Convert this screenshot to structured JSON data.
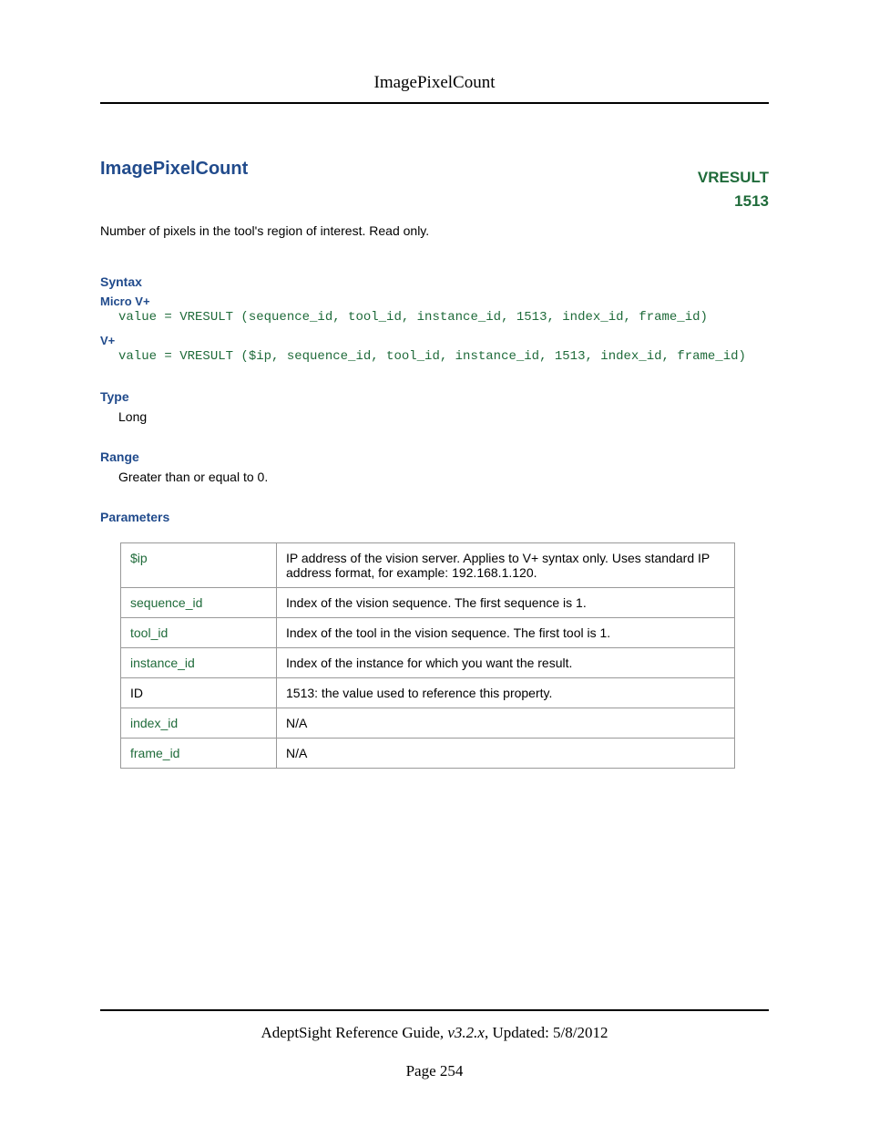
{
  "header": {
    "title": "ImagePixelCount"
  },
  "title_row": {
    "main_title": "ImagePixelCount",
    "vresult_label": "VRESULT",
    "vresult_number": "1513"
  },
  "intro": "Number of pixels in the tool's region of interest. Read only.",
  "syntax": {
    "label": "Syntax",
    "micro_label": "Micro V+",
    "micro_code": "value = VRESULT (sequence_id, tool_id, instance_id, 1513, index_id, frame_id)",
    "vplus_label": "V+",
    "vplus_code": "value = VRESULT ($ip, sequence_id, tool_id, instance_id, 1513, index_id, frame_id)"
  },
  "type": {
    "label": "Type",
    "value": "Long"
  },
  "range": {
    "label": "Range",
    "value": "Greater than or equal to 0."
  },
  "parameters": {
    "label": "Parameters",
    "rows": [
      {
        "name": "$ip",
        "desc": "IP address of the vision server. Applies to V+ syntax only. Uses standard IP address format, for example: 192.168.1.120."
      },
      {
        "name": "sequence_id",
        "desc": "Index of the vision sequence. The first sequence is 1."
      },
      {
        "name": "tool_id",
        "desc": "Index of the tool in the vision sequence. The first tool is 1."
      },
      {
        "name": "instance_id",
        "desc": "Index of the instance for which you want the result."
      },
      {
        "name": "ID",
        "desc": "1513: the value used to reference this property."
      },
      {
        "name": "index_id",
        "desc": "N/A"
      },
      {
        "name": "frame_id",
        "desc": "N/A"
      }
    ]
  },
  "footer": {
    "guide": "AdeptSight Reference Guide",
    "version": ", v3.2.x",
    "updated": ", Updated: 5/8/2012",
    "page": "Page 254"
  }
}
